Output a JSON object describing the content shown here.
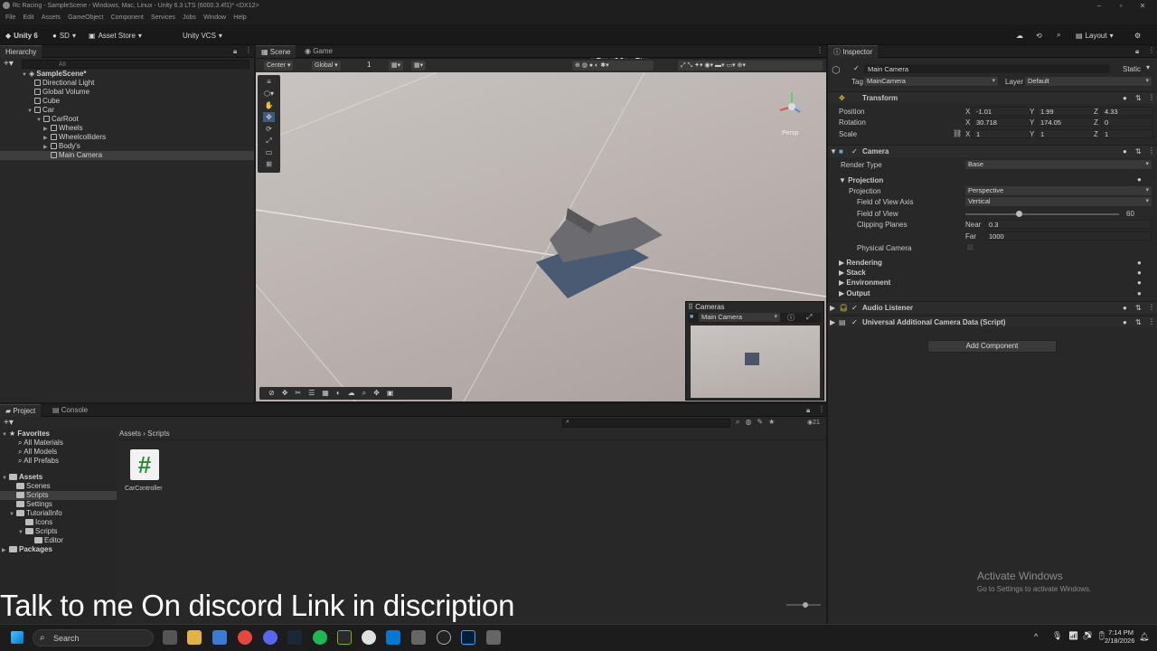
{
  "window": {
    "title": "Rc Racing - SampleScene - Windows, Mac, Linux - Unity 6.3 LTS (6000.3.4f1)* <DX12>"
  },
  "menu": [
    "File",
    "Edit",
    "Assets",
    "GameObject",
    "Component",
    "Services",
    "Jobs",
    "Window",
    "Help"
  ],
  "toolbar": {
    "unity": "Unity 6",
    "account": "SD",
    "asset_store": "Asset Store",
    "vcs": "Unity VCS",
    "layout": "Layout"
  },
  "hierarchy": {
    "tab": "Hierarchy",
    "search_placeholder": "All",
    "items": [
      {
        "label": "SampleScene*"
      },
      {
        "label": "Directional Light"
      },
      {
        "label": "Global Volume"
      },
      {
        "label": "Cube"
      },
      {
        "label": "Car"
      },
      {
        "label": "CarRoot"
      },
      {
        "label": "Wheels"
      },
      {
        "label": "Wheelcolliders"
      },
      {
        "label": "Body's"
      },
      {
        "label": "Main Camera"
      }
    ]
  },
  "scene": {
    "tab_scene": "Scene",
    "tab_game": "Game",
    "pivot": "Center",
    "space": "Global",
    "snap": "1",
    "gizmo_label": "Persp"
  },
  "cameras_overlay": {
    "title": "Cameras",
    "selected": "Main Camera"
  },
  "inspector": {
    "tab": "Inspector",
    "object_name": "Main Camera",
    "static": "Static",
    "tag_label": "Tag",
    "tag": "MainCamera",
    "layer_label": "Layer",
    "layer": "Default",
    "transform": {
      "title": "Transform",
      "position_label": "Position",
      "rotation_label": "Rotation",
      "scale_label": "Scale",
      "position": {
        "x": "-1.01",
        "y": "1.99",
        "z": "4.33"
      },
      "rotation": {
        "x": "30.718",
        "y": "174.05",
        "z": "0"
      },
      "scale": {
        "x": "1",
        "y": "1",
        "z": "1"
      },
      "axis_x": "X",
      "axis_y": "Y",
      "axis_z": "Z"
    },
    "camera": {
      "title": "Camera",
      "render_type_label": "Render Type",
      "render_type": "Base",
      "projection_section": "Projection",
      "projection_label": "Projection",
      "projection": "Perspective",
      "fov_axis_label": "Field of View Axis",
      "fov_axis": "Vertical",
      "fov_label": "Field of View",
      "fov": "60",
      "fov_fraction": 0.33,
      "clipping_label": "Clipping Planes",
      "near_label": "Near",
      "near": "0.3",
      "far_label": "Far",
      "far": "1000",
      "physical_label": "Physical Camera",
      "rendering": "Rendering",
      "stack": "Stack",
      "environment": "Environment",
      "output": "Output"
    },
    "audio_listener": "Audio Listener",
    "urp_data": "Universal Additional Camera Data (Script)",
    "add_component": "Add Component"
  },
  "project": {
    "tab_project": "Project",
    "tab_console": "Console",
    "breadcrumb_root": "Assets",
    "breadcrumb_leaf": "Scripts",
    "count": "21",
    "favorites": "Favorites",
    "fav_items": [
      "All Materials",
      "All Models",
      "All Prefabs"
    ],
    "assets": "Assets",
    "asset_items": [
      "Scenes",
      "Scripts",
      "Settings",
      "TutorialInfo",
      "Icons",
      "Scripts",
      "Editor"
    ],
    "packages": "Packages",
    "file_name": "CarController"
  },
  "caption": "Talk to me On discord Link in discription",
  "watermark": {
    "title": "Activate Windows",
    "sub": "Go to Settings to activate Windows."
  },
  "taskbar": {
    "search": "Search",
    "time": "7:14 PM",
    "date": "2/18/2026"
  }
}
